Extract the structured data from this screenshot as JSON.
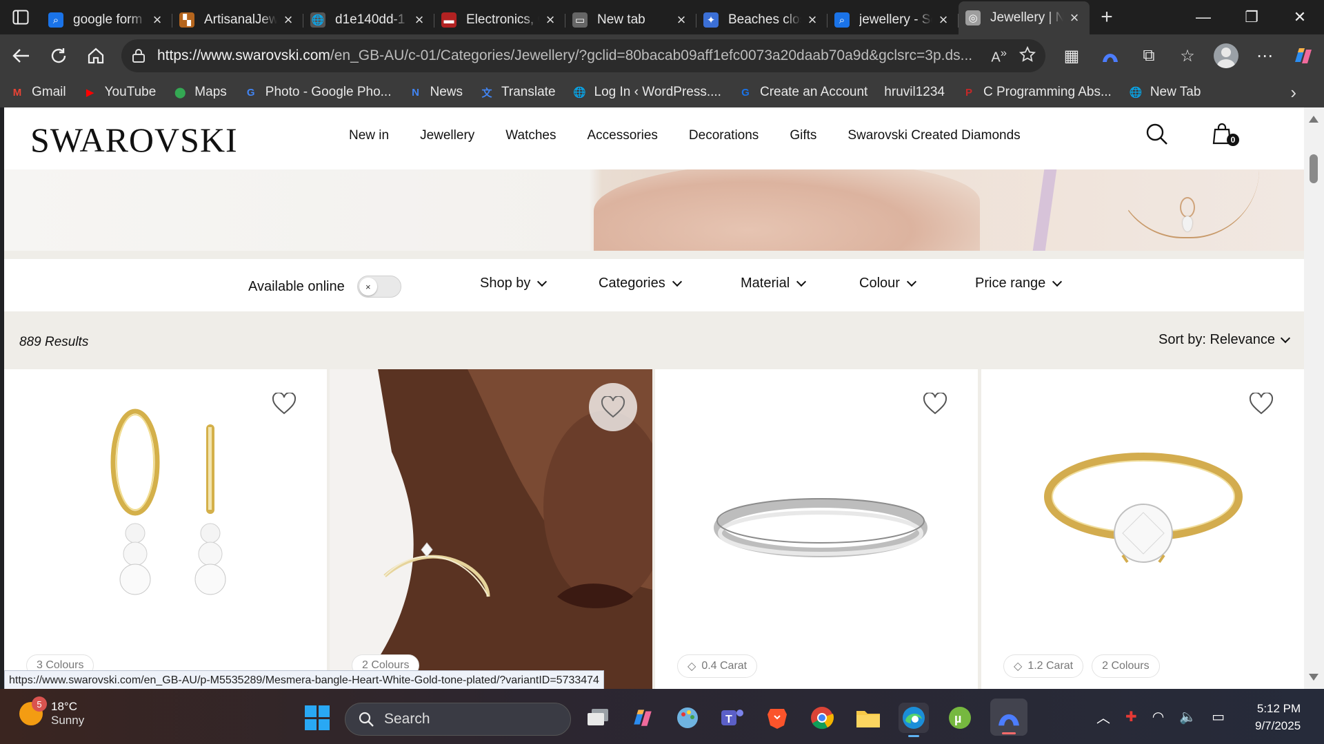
{
  "browser": {
    "tabs": [
      {
        "title": "google form",
        "favicon_color": "#1a73e8",
        "favicon_glyph": "⌕"
      },
      {
        "title": "ArtisanalJew",
        "favicon_color": "#b5651d",
        "favicon_glyph": "▚"
      },
      {
        "title": "d1e140dd-1",
        "favicon_color": "#555555",
        "favicon_glyph": "🌐"
      },
      {
        "title": "Electronics, C",
        "favicon_color": "#b22222",
        "favicon_glyph": "▬"
      },
      {
        "title": "New tab",
        "favicon_color": "#666666",
        "favicon_glyph": "▭"
      },
      {
        "title": "Beaches clos",
        "favicon_color": "#3b6fd6",
        "favicon_glyph": "✦"
      },
      {
        "title": "jewellery - Se",
        "favicon_color": "#1a73e8",
        "favicon_glyph": "⌕"
      },
      {
        "title": "Jewellery | N",
        "favicon_color": "#9e9e9e",
        "favicon_glyph": "◎",
        "active": true
      }
    ],
    "url_domain": "https://www.swarovski.com",
    "url_path": "/en_GB-AU/c-01/Categories/Jewellery/?gclid=80bacab09aff1efc0073a20daab70a9d&gclsrc=3p.ds...",
    "bookmarks": [
      {
        "label": "Gmail",
        "icon": "gmail-icon",
        "color": "#ea4335",
        "glyph": "M"
      },
      {
        "label": "YouTube",
        "icon": "youtube-icon",
        "color": "#ff0000",
        "glyph": "▶"
      },
      {
        "label": "Maps",
        "icon": "maps-icon",
        "color": "#34a853",
        "glyph": "⬤"
      },
      {
        "label": "Photo - Google Pho...",
        "icon": "google-icon",
        "color": "#4285f4",
        "glyph": "G"
      },
      {
        "label": "News",
        "icon": "news-icon",
        "color": "#4285f4",
        "glyph": "N"
      },
      {
        "label": "Translate",
        "icon": "translate-icon",
        "color": "#4285f4",
        "glyph": "文"
      },
      {
        "label": "Log In ‹ WordPress....",
        "icon": "globe-icon",
        "color": "#555555",
        "glyph": "🌐"
      },
      {
        "label": "Create an Account",
        "icon": "account-icon",
        "color": "#1a73e8",
        "glyph": "G"
      },
      {
        "label": "hruvil1234",
        "icon": "",
        "color": "#3b3b3b",
        "glyph": ""
      },
      {
        "label": "C Programming Abs...",
        "icon": "pdf-icon",
        "color": "#c62828",
        "glyph": "P"
      },
      {
        "label": "New Tab",
        "icon": "globe-icon",
        "color": "#555555",
        "glyph": "🌐"
      }
    ]
  },
  "site": {
    "logo": "SWAROVSKI",
    "nav": [
      "New in",
      "Jewellery",
      "Watches",
      "Accessories",
      "Decorations",
      "Gifts",
      "Swarovski Created Diamonds"
    ],
    "cart_count": "0",
    "filters": {
      "available_online": "Available online",
      "toggle_glyph": "×",
      "dropdowns": [
        "Shop by",
        "Categories",
        "Material",
        "Colour",
        "Price range"
      ]
    },
    "results": "889 Results",
    "sort": "Sort by: Relevance",
    "products": [
      {
        "name": "gold hoop drop earrings",
        "chips": [
          "3 Colours"
        ]
      },
      {
        "name": "bangle on model",
        "chips": [
          "2 Colours"
        ]
      },
      {
        "name": "silver eternity ring",
        "chips": [
          "0.4 Carat"
        ]
      },
      {
        "name": "gold solitaire ring",
        "chips": [
          "1.2 Carat",
          "2 Colours"
        ]
      }
    ]
  },
  "status_url": "https://www.swarovski.com/en_GB-AU/p-M5535289/Mesmera-bangle-Heart-White-Gold-tone-plated/?variantID=5733474",
  "taskbar": {
    "weather_temp": "18°C",
    "weather_desc": "Sunny",
    "weather_badge": "5",
    "search_label": "Search",
    "time": "5:12 PM",
    "date": "9/7/2025"
  }
}
